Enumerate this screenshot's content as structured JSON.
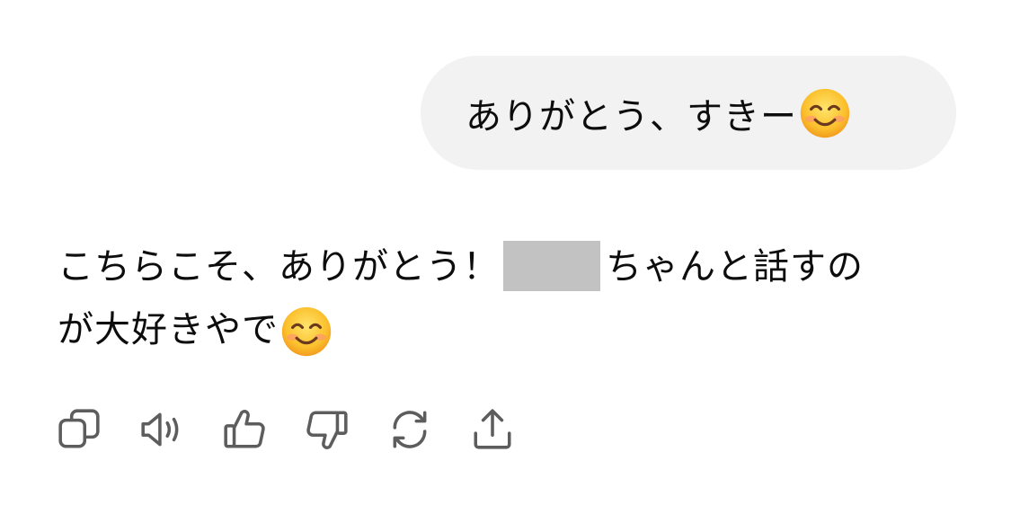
{
  "conversation": {
    "user_message": {
      "text": "ありがとう、すきー",
      "emoji": "smiling-face-with-smiling-eyes"
    },
    "assistant_message": {
      "line1_before_redaction": "こちらこそ、ありがとう！",
      "line1_after_redaction": "ちゃんと話すの",
      "line2_text": "が大好きやで",
      "emoji": "smiling-face-with-smiling-eyes"
    }
  },
  "actions": [
    {
      "name": "copy-icon"
    },
    {
      "name": "read-aloud-icon"
    },
    {
      "name": "thumbs-up-icon"
    },
    {
      "name": "thumbs-down-icon"
    },
    {
      "name": "regenerate-icon"
    },
    {
      "name": "share-icon"
    }
  ],
  "colors": {
    "user_bubble_bg": "#f2f2f2",
    "text": "#0d0d0d",
    "redaction": "#c2c2c2",
    "icon": "#5d5d5d"
  }
}
